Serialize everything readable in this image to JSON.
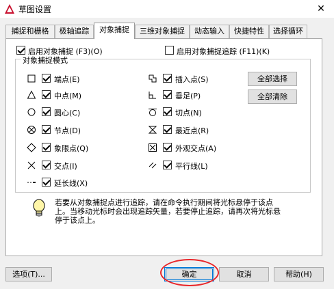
{
  "window": {
    "title": "草图设置",
    "close_glyph": "✕"
  },
  "tabs": [
    {
      "label": "捕捉和栅格",
      "active": false
    },
    {
      "label": "极轴追踪",
      "active": false
    },
    {
      "label": "对象捕捉",
      "active": true
    },
    {
      "label": "三维对象捕捉",
      "active": false
    },
    {
      "label": "动态输入",
      "active": false
    },
    {
      "label": "快捷特性",
      "active": false
    },
    {
      "label": "选择循环",
      "active": false
    }
  ],
  "options": {
    "enable_snap": {
      "label": "启用对象捕捉 (F3)(O)",
      "checked": true
    },
    "enable_tracking": {
      "label": "启用对象捕捉追踪 (F11)(K)",
      "checked": false
    }
  },
  "group": {
    "title": "对象捕捉模式",
    "left_items": [
      {
        "label": "端点(E)",
        "checked": true,
        "icon": "endpoint-square-icon"
      },
      {
        "label": "中点(M)",
        "checked": true,
        "icon": "midpoint-triangle-icon"
      },
      {
        "label": "圆心(C)",
        "checked": true,
        "icon": "center-circle-icon"
      },
      {
        "label": "节点(D)",
        "checked": true,
        "icon": "node-icon"
      },
      {
        "label": "象限点(Q)",
        "checked": true,
        "icon": "quadrant-diamond-icon"
      },
      {
        "label": "交点(I)",
        "checked": true,
        "icon": "intersection-x-icon"
      },
      {
        "label": "延长线(X)",
        "checked": true,
        "icon": "extension-icon"
      }
    ],
    "right_items": [
      {
        "label": "插入点(S)",
        "checked": true,
        "icon": "insertion-icon"
      },
      {
        "label": "垂足(P)",
        "checked": true,
        "icon": "perpendicular-icon"
      },
      {
        "label": "切点(N)",
        "checked": true,
        "icon": "tangent-icon"
      },
      {
        "label": "最近点(R)",
        "checked": true,
        "icon": "nearest-icon"
      },
      {
        "label": "外观交点(A)",
        "checked": true,
        "icon": "apparent-intersection-icon"
      },
      {
        "label": "平行线(L)",
        "checked": true,
        "icon": "parallel-icon"
      }
    ],
    "select_all_label": "全部选择",
    "clear_all_label": "全部清除"
  },
  "hint": {
    "text": "若要从对象捕捉点进行追踪，请在命令执行期间将光标悬停于该点上。当移动光标时会出现追踪矢量，若要停止追踪，请再次将光标悬停于该点上。"
  },
  "footer": {
    "options_label": "选项(T)...",
    "ok_label": "确定",
    "cancel_label": "取消",
    "help_label": "帮助(H)"
  },
  "highlight_color": "#e8262a"
}
